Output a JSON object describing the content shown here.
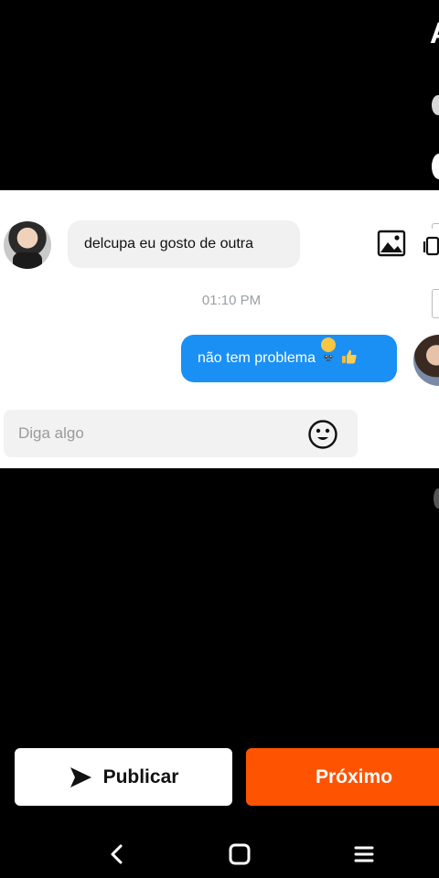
{
  "edge_glyph": "A",
  "chat": {
    "messages": [
      {
        "side": "incoming",
        "text": "delcupa eu gosto de outra"
      },
      {
        "side": "outgoing",
        "text": "não tem problema"
      }
    ],
    "timestamp": "01:10 PM"
  },
  "composer": {
    "placeholder": "Diga algo"
  },
  "actions": {
    "publish_label": "Publicar",
    "next_label": "Próximo"
  },
  "icons": [
    "emoji-icon",
    "image-icon",
    "send-icon",
    "back-icon",
    "home-icon",
    "menu-icon"
  ],
  "colors": {
    "outgoing_bubble": "#1a90f5",
    "incoming_bubble": "#f1f1f1",
    "next_button": "#fe5300",
    "background": "#000000"
  }
}
